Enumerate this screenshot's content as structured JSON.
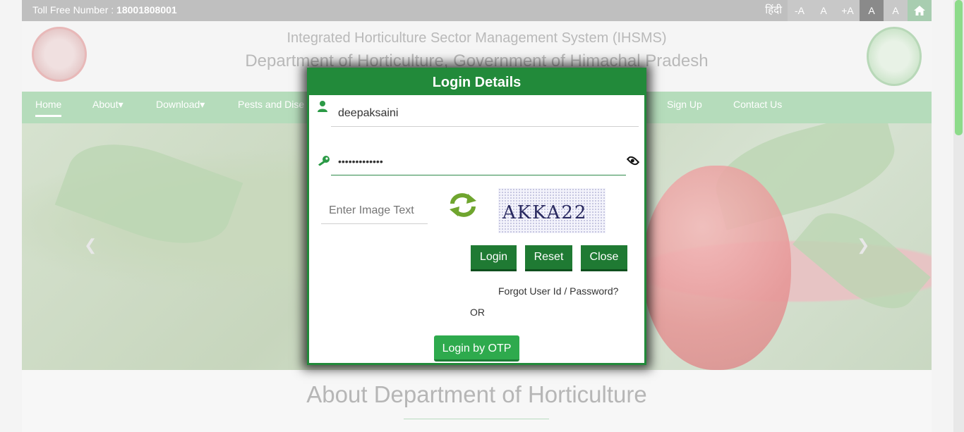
{
  "topbar": {
    "toll_label": "Toll Free Number :",
    "toll_number": "18001808001",
    "language": "हिंदी",
    "font_buttons": [
      "-A",
      "A",
      "+A",
      "A",
      "A"
    ]
  },
  "header": {
    "line1": "Integrated Horticulture Sector Management System (IHSMS)",
    "line2": "Department of Horticulture, Government of Himachal Pradesh"
  },
  "nav": {
    "items": [
      "Home",
      "About▾",
      "Download▾",
      "Pests and Dise",
      "Sign Up",
      "Contact Us"
    ]
  },
  "about": {
    "title": "About Department of Horticulture"
  },
  "modal": {
    "title": "Login Details",
    "username_value": "deepaksaini",
    "password_value": "•••••••••••••",
    "captcha_placeholder": "Enter Image Text",
    "captcha_text": "AKKA22",
    "login_label": "Login",
    "reset_label": "Reset",
    "close_label": "Close",
    "forgot_label": "Forgot User Id / Password?",
    "or_label": "OR",
    "otp_label": "Login by OTP"
  }
}
